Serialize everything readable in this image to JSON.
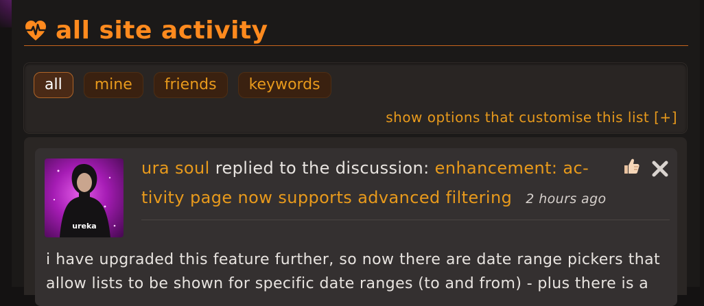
{
  "header": {
    "title": "all site activity",
    "icon": "heart-pulse-icon",
    "accent_color": "#ff8a1e"
  },
  "filters": {
    "tabs": [
      {
        "label": "all",
        "active": true
      },
      {
        "label": "mine",
        "active": false
      },
      {
        "label": "friends",
        "active": false
      },
      {
        "label": "keywords",
        "active": false
      }
    ],
    "show_options_label": "show options that customise this list [+]"
  },
  "activity": {
    "author": "ura soul",
    "action_text": "replied to the discussion:",
    "discussion_title": "enhancement: activity page now supports advanced filtering",
    "discussion_title_line1": "enhancement: ac-",
    "discussion_title_line2": "tivity page now supports advanced filtering",
    "time_ago": "2 hours ago",
    "avatar_logo_text": "ureka",
    "like_icon": "thumbs-up-icon",
    "dismiss_icon": "close-icon",
    "body_line1": "i have upgraded this feature further, so now there are date range pickers that",
    "body_line2": "allow lists to be shown for specific date ranges (to and from) - plus there is a"
  }
}
